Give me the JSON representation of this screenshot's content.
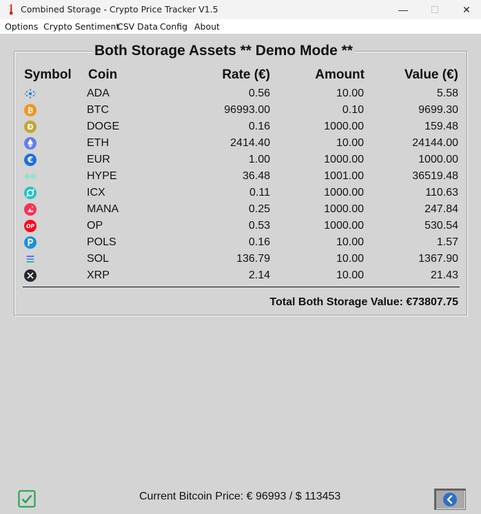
{
  "window": {
    "title": "Combined Storage - Crypto Price Tracker V1.5",
    "minimize": "—",
    "maximize": "☐",
    "close": "✕"
  },
  "menu": [
    "Options",
    "Crypto Sentiment",
    "CSV Data",
    "Config",
    "About"
  ],
  "panel": {
    "title": "Both Storage Assets ** Demo Mode **",
    "columns": {
      "symbol": "Symbol",
      "coin": "Coin",
      "rate": "Rate (€)",
      "amount": "Amount",
      "value": "Value (€)"
    },
    "rows": [
      {
        "coin": "ADA",
        "rate": "0.56",
        "amount": "10.00",
        "value": "5.58",
        "icon": "cardano-icon",
        "color": "#2a6cd8"
      },
      {
        "coin": "BTC",
        "rate": "96993.00",
        "amount": "0.10",
        "value": "9699.30",
        "icon": "bitcoin-icon",
        "color": "#f7931a"
      },
      {
        "coin": "DOGE",
        "rate": "0.16",
        "amount": "1000.00",
        "value": "159.48",
        "icon": "dogecoin-icon",
        "color": "#c2a633"
      },
      {
        "coin": "ETH",
        "rate": "2414.40",
        "amount": "10.00",
        "value": "24144.00",
        "icon": "ethereum-icon",
        "color": "#627eea"
      },
      {
        "coin": "EUR",
        "rate": "1.00",
        "amount": "1000.00",
        "value": "1000.00",
        "icon": "euro-icon",
        "color": "#1e6fe0"
      },
      {
        "coin": "HYPE",
        "rate": "36.48",
        "amount": "1001.00",
        "value": "36519.48",
        "icon": "hyperliquid-icon",
        "color": "#8fe3d0"
      },
      {
        "coin": "ICX",
        "rate": "0.11",
        "amount": "1000.00",
        "value": "110.63",
        "icon": "icon-icx-icon",
        "color": "#1fc5c9"
      },
      {
        "coin": "MANA",
        "rate": "0.25",
        "amount": "1000.00",
        "value": "247.84",
        "icon": "decentraland-icon",
        "color": "#ff2d55"
      },
      {
        "coin": "OP",
        "rate": "0.53",
        "amount": "1000.00",
        "value": "530.54",
        "icon": "optimism-icon",
        "color": "#ff0420"
      },
      {
        "coin": "POLS",
        "rate": "0.16",
        "amount": "10.00",
        "value": "1.57",
        "icon": "polkastarter-icon",
        "color": "#1a8fe0"
      },
      {
        "coin": "SOL",
        "rate": "136.79",
        "amount": "10.00",
        "value": "1367.90",
        "icon": "solana-icon",
        "color": "#9945ff"
      },
      {
        "coin": "XRP",
        "rate": "2.14",
        "amount": "10.00",
        "value": "21.43",
        "icon": "xrp-icon",
        "color": "#23292f"
      }
    ],
    "op_label": "OP",
    "total": "Total Both Storage Value: €73807.75"
  },
  "footer": {
    "price": "Current Bitcoin Price: € 96993 / $ 113453",
    "accent": "#1aa04a",
    "back_color": "#2f6fc9"
  }
}
